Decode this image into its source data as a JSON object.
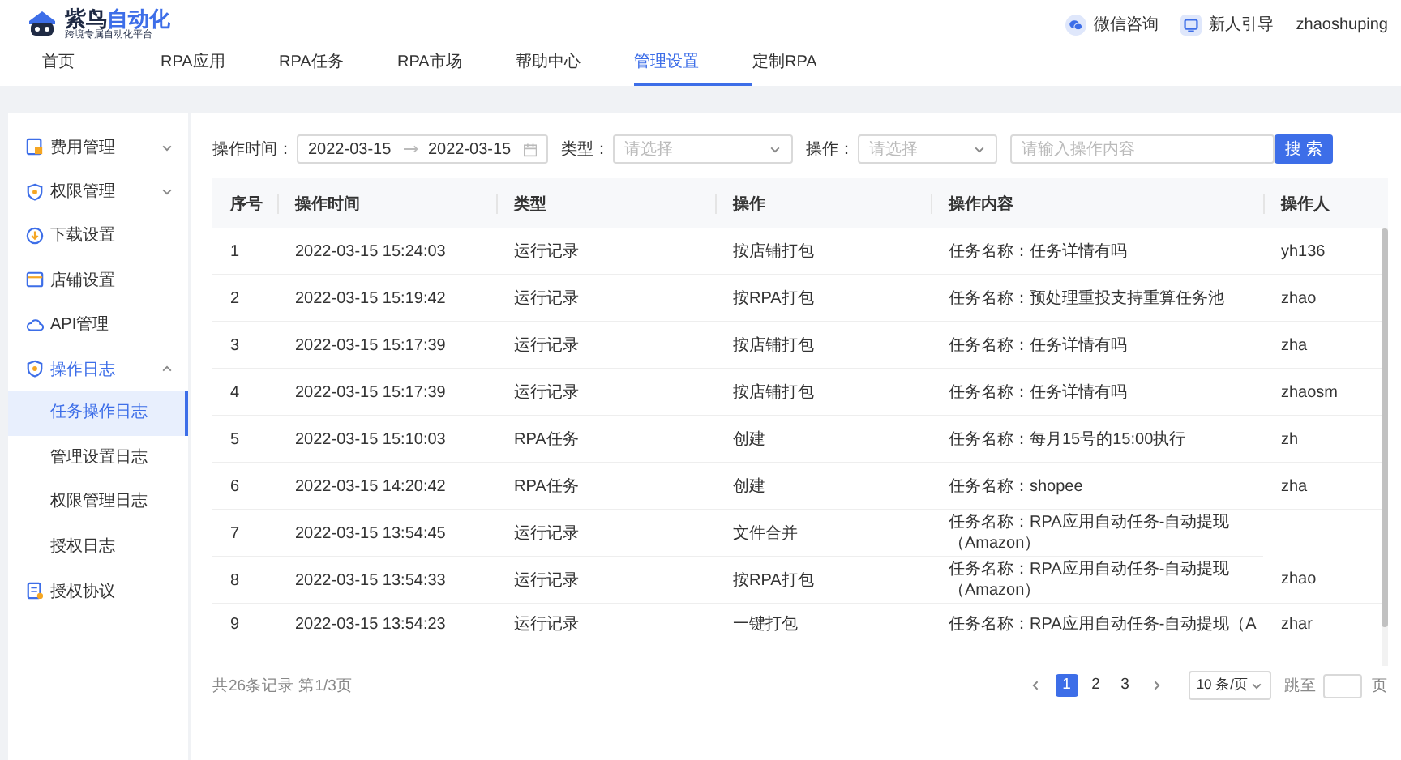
{
  "header": {
    "logo": {
      "name_dark": "紫鸟",
      "name_accent": "自动化",
      "tagline": "跨境专属自动化平台"
    },
    "links": [
      {
        "kind": "chat",
        "label": "微信咨询"
      },
      {
        "kind": "guide",
        "label": "新人引导"
      }
    ],
    "username": "zhaoshuping"
  },
  "nav": [
    {
      "label": "首页",
      "selected": false
    },
    {
      "label": "RPA应用",
      "selected": false
    },
    {
      "label": "RPA任务",
      "selected": false
    },
    {
      "label": "RPA市场",
      "selected": false
    },
    {
      "label": "帮助中心",
      "selected": false
    },
    {
      "label": "管理设置",
      "selected": true
    },
    {
      "label": "定制RPA",
      "selected": false
    }
  ],
  "sidebar": {
    "items": [
      {
        "label": "费用管理",
        "expanded": false
      },
      {
        "label": "权限管理",
        "expanded": false
      },
      {
        "label": "下载设置"
      },
      {
        "label": "店铺设置"
      },
      {
        "label": "API管理"
      },
      {
        "label": "操作日志",
        "expanded": true,
        "children": [
          {
            "label": "任务操作日志",
            "selected": true
          },
          {
            "label": "管理设置日志",
            "selected": false
          },
          {
            "label": "权限管理日志",
            "selected": false
          },
          {
            "label": "授权日志",
            "selected": false
          }
        ]
      },
      {
        "label": "授权协议"
      }
    ]
  },
  "filters": {
    "time_label": "操作时间：",
    "date_start": "2022-03-15",
    "date_end": "2022-03-15",
    "type_label": "类型：",
    "type_placeholder": "请选择",
    "op_label": "操作：",
    "op_placeholder": "请选择",
    "content_placeholder": "请输入操作内容",
    "search_button": "搜 索"
  },
  "table": {
    "columns": [
      "序号",
      "操作时间",
      "类型",
      "操作",
      "操作内容",
      "操作人"
    ],
    "rows": [
      [
        "1",
        "2022-03-15 15:24:03",
        "运行记录",
        "按店铺打包",
        "任务名称：任务详情有吗",
        "yh136"
      ],
      [
        "2",
        "2022-03-15 15:19:42",
        "运行记录",
        "按RPA打包",
        "任务名称：预处理重投支持重算任务池",
        "zhao"
      ],
      [
        "3",
        "2022-03-15 15:17:39",
        "运行记录",
        "按店铺打包",
        "任务名称：任务详情有吗",
        "zha"
      ],
      [
        "4",
        "2022-03-15 15:17:39",
        "运行记录",
        "按店铺打包",
        "任务名称：任务详情有吗",
        "zhaosm"
      ],
      [
        "5",
        "2022-03-15 15:10:03",
        "RPA任务",
        "创建",
        "任务名称：每月15号的15:00执行",
        "zh"
      ],
      [
        "6",
        "2022-03-15 14:20:42",
        "RPA任务",
        "创建",
        "任务名称：shopee",
        "zha"
      ],
      [
        "7",
        "2022-03-15 13:54:45",
        "运行记录",
        "文件合并",
        "任务名称：RPA应用自动任务-自动提现（Amazon）"
      ],
      [
        "8",
        "2022-03-15 13:54:33",
        "运行记录",
        "按RPA打包",
        "任务名称：RPA应用自动任务-自动提现（Amazon）",
        "zhao"
      ],
      [
        "9",
        "2022-03-15 13:54:23",
        "运行记录",
        "一键打包",
        "任务名称：RPA应用自动任务-自动提现（A",
        "zhar"
      ]
    ]
  },
  "pagination": {
    "summary": "共26条记录 第1/3页",
    "pages": [
      {
        "label": "1",
        "selected": true
      },
      {
        "label": "2",
        "selected": false
      },
      {
        "label": "3",
        "selected": false
      }
    ],
    "page_size": "10 条/页",
    "jump_label": "跳至",
    "page_suffix": "页"
  }
}
